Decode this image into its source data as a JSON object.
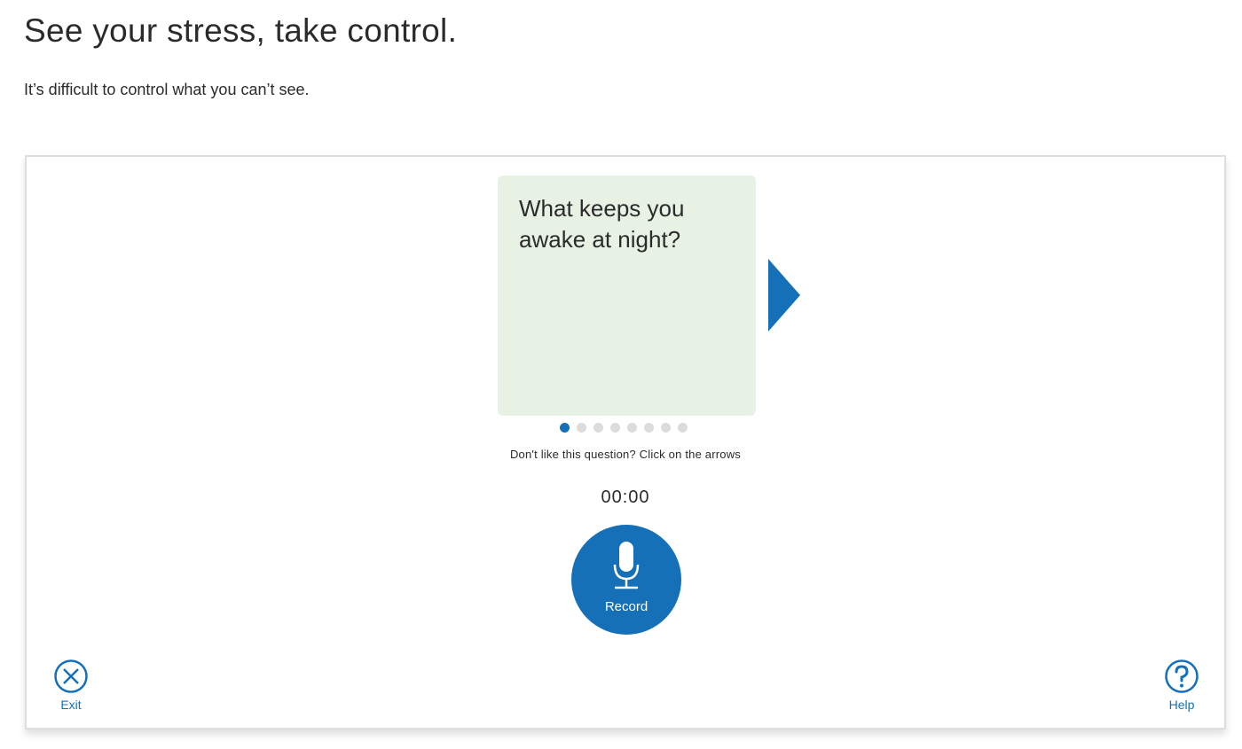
{
  "header": {
    "title": "See your stress, take control.",
    "subtitle": "It’s difficult to control what you can’t see."
  },
  "card": {
    "question": "What keeps you awake at night?"
  },
  "carousel": {
    "total_questions": 8,
    "current_index": 0,
    "hint": "Don't like this question? Click on the arrows",
    "next_icon": "triangle-right-icon"
  },
  "recorder": {
    "timer": "00:00",
    "record_label": "Record",
    "mic_icon": "microphone-icon"
  },
  "footer": {
    "exit_label": "Exit",
    "exit_icon": "close-circle-icon",
    "help_label": "Help",
    "help_icon": "question-circle-icon"
  },
  "colors": {
    "accent": "#1570b7",
    "card_bg": "#e7f1e4",
    "dot_inactive": "#dcdcdc",
    "text": "#2b2b2b"
  }
}
